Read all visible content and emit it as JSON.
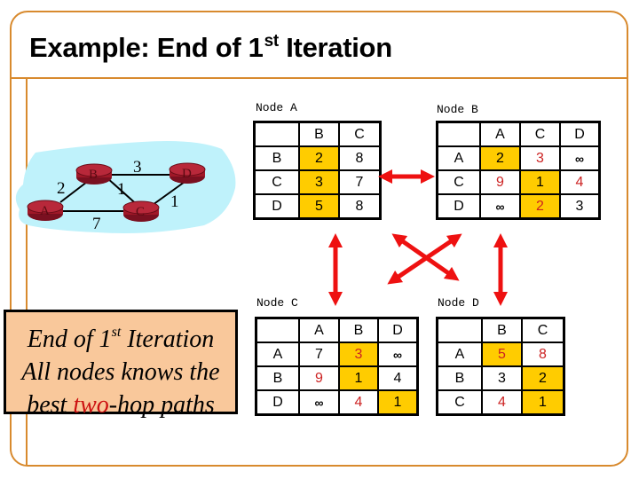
{
  "slide": {
    "title_main": "Example: End of 1",
    "title_sup": "st",
    "title_rest": " Iteration",
    "frame_color": "#d88a2e"
  },
  "network": {
    "cloud_color": "#bff2fb",
    "router_color": "#a01828",
    "nodes": [
      {
        "id": "A",
        "label": "A"
      },
      {
        "id": "B",
        "label": "B"
      },
      {
        "id": "C",
        "label": "C"
      },
      {
        "id": "D",
        "label": "D"
      }
    ],
    "links": [
      {
        "from": "A",
        "to": "B",
        "cost": "2"
      },
      {
        "from": "A",
        "to": "C",
        "cost": "7"
      },
      {
        "from": "B",
        "to": "C",
        "cost": "1"
      },
      {
        "from": "B",
        "to": "D",
        "cost": "3"
      },
      {
        "from": "C",
        "to": "D",
        "cost": "1"
      }
    ]
  },
  "tables": {
    "highlight_color": "#ffcc00",
    "changed_value_color": "#cc2222",
    "node_a": {
      "label": "Node A",
      "columns": [
        "",
        "B",
        "C"
      ],
      "rows": [
        {
          "dest": "B",
          "cells": [
            {
              "v": "2",
              "hl": true,
              "red": false
            },
            {
              "v": "8",
              "hl": false,
              "red": false
            }
          ]
        },
        {
          "dest": "C",
          "cells": [
            {
              "v": "3",
              "hl": true,
              "red": false
            },
            {
              "v": "7",
              "hl": false,
              "red": false
            }
          ]
        },
        {
          "dest": "D",
          "cells": [
            {
              "v": "5",
              "hl": true,
              "red": false
            },
            {
              "v": "8",
              "hl": false,
              "red": false
            }
          ]
        }
      ]
    },
    "node_b": {
      "label": "Node B",
      "columns": [
        "",
        "A",
        "C",
        "D"
      ],
      "rows": [
        {
          "dest": "A",
          "cells": [
            {
              "v": "2",
              "hl": true,
              "red": false
            },
            {
              "v": "3",
              "hl": false,
              "red": true
            },
            {
              "v": "∞",
              "hl": false,
              "red": false
            }
          ]
        },
        {
          "dest": "C",
          "cells": [
            {
              "v": "9",
              "hl": false,
              "red": true
            },
            {
              "v": "1",
              "hl": true,
              "red": false
            },
            {
              "v": "4",
              "hl": false,
              "red": true
            }
          ]
        },
        {
          "dest": "D",
          "cells": [
            {
              "v": "∞",
              "hl": false,
              "red": false
            },
            {
              "v": "2",
              "hl": true,
              "red": true
            },
            {
              "v": "3",
              "hl": false,
              "red": false
            }
          ]
        }
      ]
    },
    "node_c": {
      "label": "Node C",
      "columns": [
        "",
        "A",
        "B",
        "D"
      ],
      "rows": [
        {
          "dest": "A",
          "cells": [
            {
              "v": "7",
              "hl": false,
              "red": false
            },
            {
              "v": "3",
              "hl": true,
              "red": true
            },
            {
              "v": "∞",
              "hl": false,
              "red": false
            }
          ]
        },
        {
          "dest": "B",
          "cells": [
            {
              "v": "9",
              "hl": false,
              "red": true
            },
            {
              "v": "1",
              "hl": true,
              "red": false
            },
            {
              "v": "4",
              "hl": false,
              "red": false
            }
          ]
        },
        {
          "dest": "D",
          "cells": [
            {
              "v": "∞",
              "hl": false,
              "red": false
            },
            {
              "v": "4",
              "hl": false,
              "red": true
            },
            {
              "v": "1",
              "hl": true,
              "red": false
            }
          ]
        }
      ]
    },
    "node_d": {
      "label": "Node D",
      "columns": [
        "",
        "B",
        "C"
      ],
      "rows": [
        {
          "dest": "A",
          "cells": [
            {
              "v": "5",
              "hl": true,
              "red": true
            },
            {
              "v": "8",
              "hl": false,
              "red": true
            }
          ]
        },
        {
          "dest": "B",
          "cells": [
            {
              "v": "3",
              "hl": false,
              "red": false
            },
            {
              "v": "2",
              "hl": true,
              "red": false
            }
          ]
        },
        {
          "dest": "C",
          "cells": [
            {
              "v": "4",
              "hl": false,
              "red": true
            },
            {
              "v": "1",
              "hl": true,
              "red": false
            }
          ]
        }
      ]
    }
  },
  "arrows": {
    "color": "#ee1111",
    "exchanges": [
      {
        "between": [
          "Node A",
          "Node B"
        ]
      },
      {
        "between": [
          "Node A",
          "Node C"
        ]
      },
      {
        "between": [
          "Node B",
          "Node D"
        ]
      },
      {
        "between": [
          "Node A",
          "Node D"
        ]
      },
      {
        "between": [
          "Node B",
          "Node C"
        ]
      }
    ]
  },
  "callout": {
    "line1_pre": "End of 1",
    "line1_sup": "st",
    "line1_post": " Iteration",
    "line2": "All nodes knows the",
    "line3_pre": "best ",
    "line3_red": "two",
    "line3_post": "-hop paths",
    "background": "#f9c89b"
  }
}
